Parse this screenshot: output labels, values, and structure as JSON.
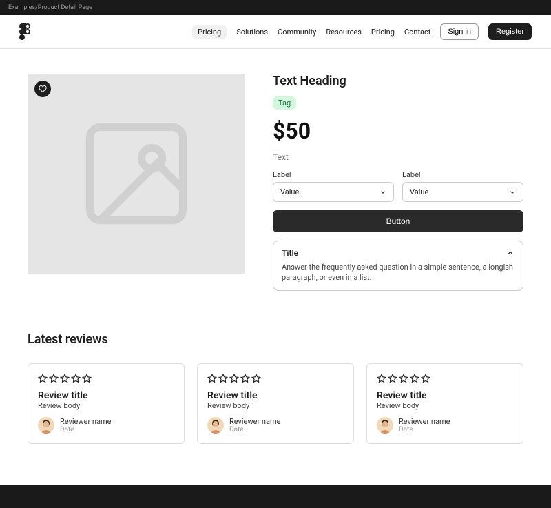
{
  "breadcrumb": "Examples/Product Detail Page",
  "nav": {
    "items": [
      "Pricing",
      "Solutions",
      "Community",
      "Resources",
      "Pricing",
      "Contact"
    ],
    "signin": "Sign in",
    "register": "Register"
  },
  "product": {
    "heading": "Text Heading",
    "tag": "Tag",
    "price": "$50",
    "desc": "Text",
    "selects": [
      {
        "label": "Label",
        "value": "Value"
      },
      {
        "label": "Label",
        "value": "Value"
      }
    ],
    "button": "Button",
    "accordion": {
      "title": "Title",
      "body": "Answer the frequently asked question in a simple sentence, a longish paragraph, or even in a list."
    }
  },
  "reviewsHeading": "Latest reviews",
  "reviews": [
    {
      "title": "Review title",
      "body": "Review body",
      "name": "Reviewer name",
      "date": "Date"
    },
    {
      "title": "Review title",
      "body": "Review body",
      "name": "Reviewer name",
      "date": "Date"
    },
    {
      "title": "Review title",
      "body": "Review body",
      "name": "Reviewer name",
      "date": "Date"
    }
  ]
}
